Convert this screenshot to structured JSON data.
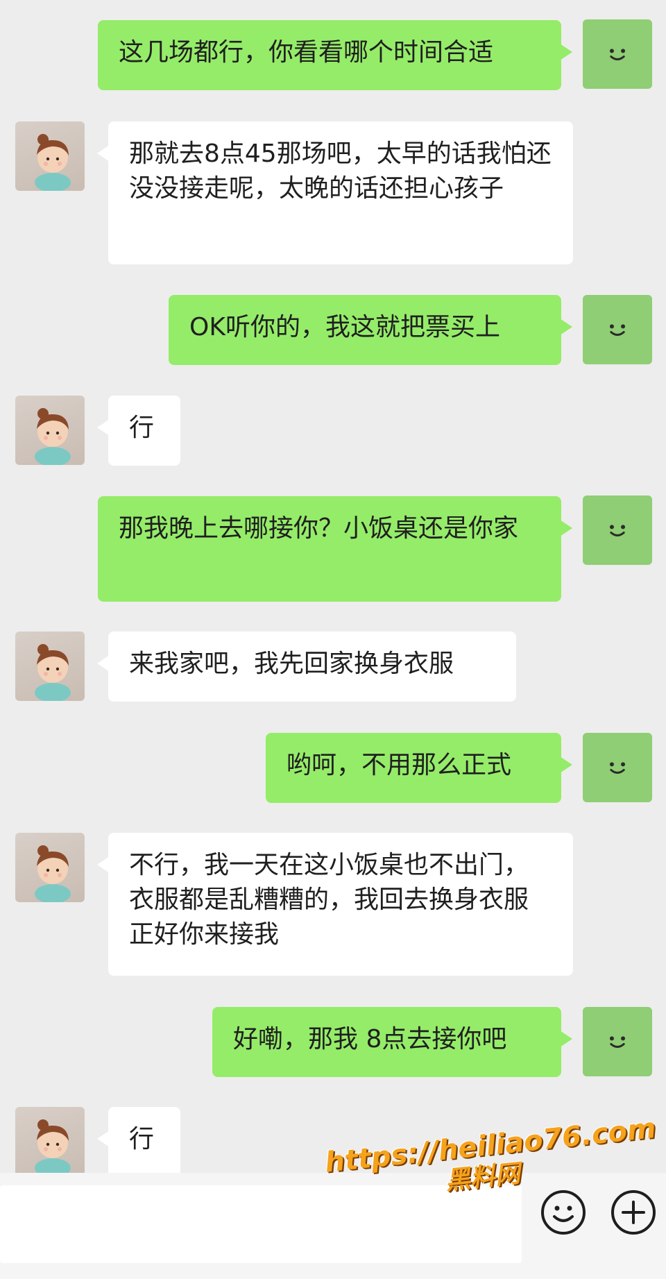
{
  "messages": [
    {
      "from": "me",
      "text": "这几场都行，你看看哪个时间合适"
    },
    {
      "from": "her",
      "text": "那就去8点45那场吧，太早的话我怕还没没接走呢，太晚的话还担心孩子"
    },
    {
      "from": "me",
      "text": "OK听你的，我这就把票买上"
    },
    {
      "from": "her",
      "text": "行"
    },
    {
      "from": "me",
      "text": "那我晚上去哪接你？小饭桌还是你家"
    },
    {
      "from": "her",
      "text": "来我家吧，我先回家换身衣服"
    },
    {
      "from": "me",
      "text": "哟呵，不用那么正式"
    },
    {
      "from": "her",
      "text": "不行，我一天在这小饭桌也不出门，衣服都是乱糟糟的，我回去换身衣服正好你来接我"
    },
    {
      "from": "me",
      "text": "好嘞，那我 8点去接你吧"
    },
    {
      "from": "her",
      "text": "行"
    }
  ],
  "input_bar": {
    "emoji_icon": "smiley-face-icon",
    "plus_icon": "plus-circle-icon"
  },
  "watermark": {
    "url": "https://heiliao76.com",
    "name": "黑料网"
  },
  "colors": {
    "background": "#ededed",
    "my_bubble": "#95ec69",
    "her_bubble": "#ffffff",
    "my_avatar": "#8fce74",
    "watermark": "#f5a21c"
  }
}
